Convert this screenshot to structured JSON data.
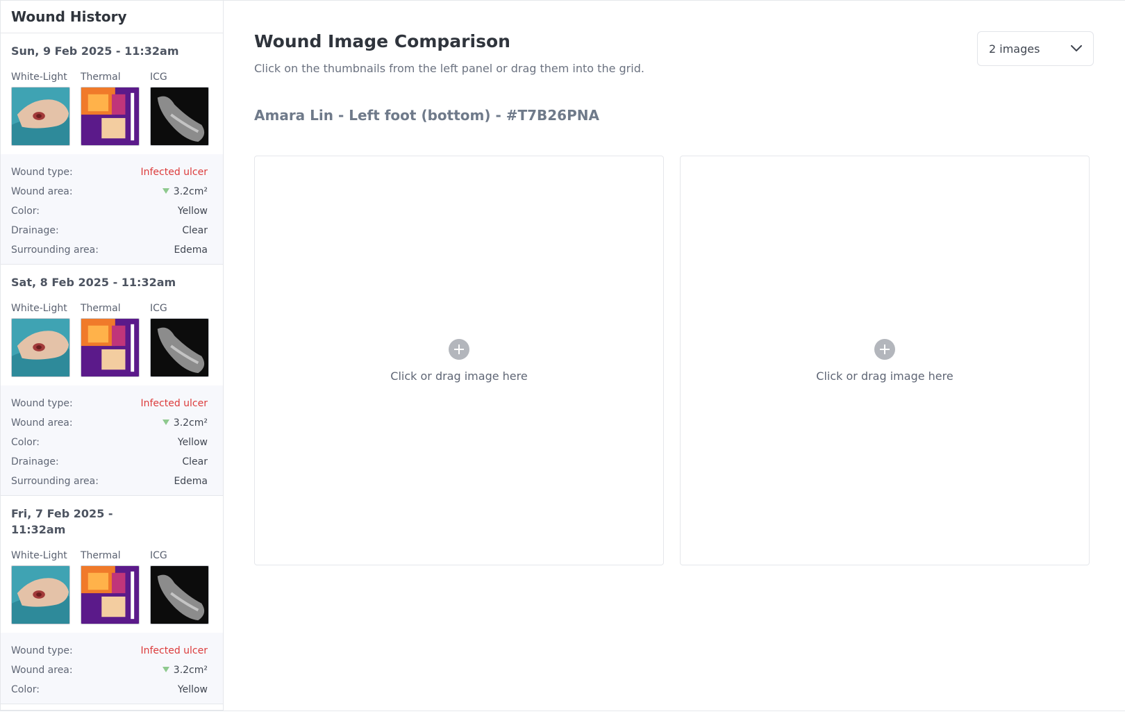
{
  "sidebar": {
    "title": "Wound History",
    "entries": [
      {
        "date": "Sun, 9 Feb 2025 - 11:32am",
        "thumbs": [
          "White-Light",
          "Thermal",
          "ICG"
        ],
        "props": [
          {
            "label": "Wound type:",
            "value": "Infected ulcer"
          },
          {
            "label": "Wound area:",
            "value": "3.2cm²"
          },
          {
            "label": "Color:",
            "value": "Yellow"
          },
          {
            "label": "Drainage:",
            "value": "Clear"
          },
          {
            "label": "Surrounding area:",
            "value": "Edema"
          }
        ]
      },
      {
        "date": "Sat, 8 Feb 2025 - 11:32am",
        "thumbs": [
          "White-Light",
          "Thermal",
          "ICG"
        ],
        "props": [
          {
            "label": "Wound type:",
            "value": "Infected ulcer"
          },
          {
            "label": "Wound area:",
            "value": "3.2cm²"
          },
          {
            "label": "Color:",
            "value": "Yellow"
          },
          {
            "label": "Drainage:",
            "value": "Clear"
          },
          {
            "label": "Surrounding area:",
            "value": "Edema"
          }
        ]
      },
      {
        "date": "Fri, 7 Feb 2025 - 11:32am",
        "thumbs": [
          "White-Light",
          "Thermal",
          "ICG"
        ],
        "props": [
          {
            "label": "Wound type:",
            "value": "Infected ulcer"
          },
          {
            "label": "Wound area:",
            "value": "3.2cm²"
          },
          {
            "label": "Color:",
            "value": "Yellow"
          }
        ]
      }
    ]
  },
  "main": {
    "title": "Wound Image Comparison",
    "subtitle": "Click on the thumbnails from the left panel or drag them into the grid.",
    "layout_select": {
      "value": "2 images"
    },
    "patient_label": "Amara Lin - Left foot (bottom) - #T7B26PNA",
    "dropzones": [
      {
        "text": "Click or drag image here"
      },
      {
        "text": "Click or drag image here"
      }
    ]
  },
  "colors": {
    "alert": "#dc3b3b",
    "trend": "#8ec98e",
    "panel_bg": "#f7f8fc"
  },
  "icons": {
    "trend": "triangle-down-icon",
    "dropzone": "plus-circle-icon",
    "select": "chevron-down-icon"
  }
}
